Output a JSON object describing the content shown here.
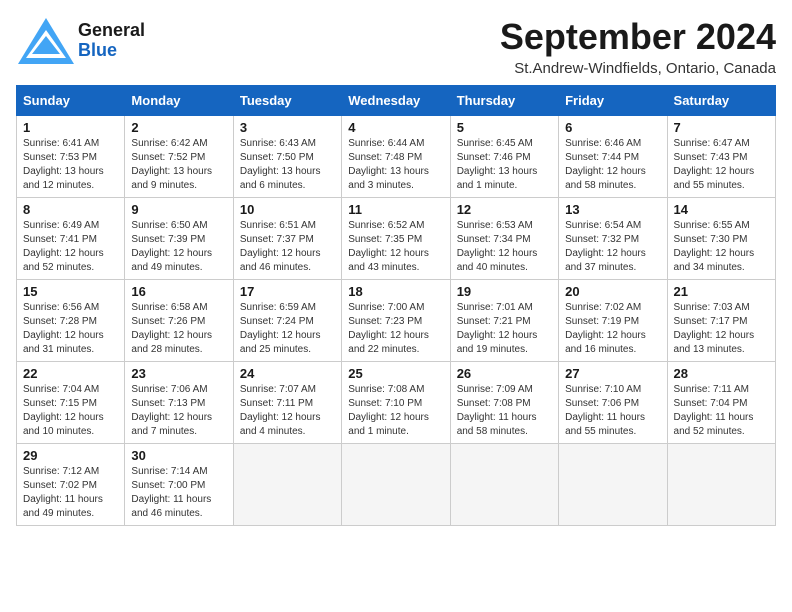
{
  "header": {
    "logo_general": "General",
    "logo_blue": "Blue",
    "month": "September 2024",
    "location": "St.Andrew-Windfields, Ontario, Canada"
  },
  "days_of_week": [
    "Sunday",
    "Monday",
    "Tuesday",
    "Wednesday",
    "Thursday",
    "Friday",
    "Saturday"
  ],
  "weeks": [
    [
      {
        "num": "1",
        "sunrise": "Sunrise: 6:41 AM",
        "sunset": "Sunset: 7:53 PM",
        "daylight": "Daylight: 13 hours and 12 minutes."
      },
      {
        "num": "2",
        "sunrise": "Sunrise: 6:42 AM",
        "sunset": "Sunset: 7:52 PM",
        "daylight": "Daylight: 13 hours and 9 minutes."
      },
      {
        "num": "3",
        "sunrise": "Sunrise: 6:43 AM",
        "sunset": "Sunset: 7:50 PM",
        "daylight": "Daylight: 13 hours and 6 minutes."
      },
      {
        "num": "4",
        "sunrise": "Sunrise: 6:44 AM",
        "sunset": "Sunset: 7:48 PM",
        "daylight": "Daylight: 13 hours and 3 minutes."
      },
      {
        "num": "5",
        "sunrise": "Sunrise: 6:45 AM",
        "sunset": "Sunset: 7:46 PM",
        "daylight": "Daylight: 13 hours and 1 minute."
      },
      {
        "num": "6",
        "sunrise": "Sunrise: 6:46 AM",
        "sunset": "Sunset: 7:44 PM",
        "daylight": "Daylight: 12 hours and 58 minutes."
      },
      {
        "num": "7",
        "sunrise": "Sunrise: 6:47 AM",
        "sunset": "Sunset: 7:43 PM",
        "daylight": "Daylight: 12 hours and 55 minutes."
      }
    ],
    [
      {
        "num": "8",
        "sunrise": "Sunrise: 6:49 AM",
        "sunset": "Sunset: 7:41 PM",
        "daylight": "Daylight: 12 hours and 52 minutes."
      },
      {
        "num": "9",
        "sunrise": "Sunrise: 6:50 AM",
        "sunset": "Sunset: 7:39 PM",
        "daylight": "Daylight: 12 hours and 49 minutes."
      },
      {
        "num": "10",
        "sunrise": "Sunrise: 6:51 AM",
        "sunset": "Sunset: 7:37 PM",
        "daylight": "Daylight: 12 hours and 46 minutes."
      },
      {
        "num": "11",
        "sunrise": "Sunrise: 6:52 AM",
        "sunset": "Sunset: 7:35 PM",
        "daylight": "Daylight: 12 hours and 43 minutes."
      },
      {
        "num": "12",
        "sunrise": "Sunrise: 6:53 AM",
        "sunset": "Sunset: 7:34 PM",
        "daylight": "Daylight: 12 hours and 40 minutes."
      },
      {
        "num": "13",
        "sunrise": "Sunrise: 6:54 AM",
        "sunset": "Sunset: 7:32 PM",
        "daylight": "Daylight: 12 hours and 37 minutes."
      },
      {
        "num": "14",
        "sunrise": "Sunrise: 6:55 AM",
        "sunset": "Sunset: 7:30 PM",
        "daylight": "Daylight: 12 hours and 34 minutes."
      }
    ],
    [
      {
        "num": "15",
        "sunrise": "Sunrise: 6:56 AM",
        "sunset": "Sunset: 7:28 PM",
        "daylight": "Daylight: 12 hours and 31 minutes."
      },
      {
        "num": "16",
        "sunrise": "Sunrise: 6:58 AM",
        "sunset": "Sunset: 7:26 PM",
        "daylight": "Daylight: 12 hours and 28 minutes."
      },
      {
        "num": "17",
        "sunrise": "Sunrise: 6:59 AM",
        "sunset": "Sunset: 7:24 PM",
        "daylight": "Daylight: 12 hours and 25 minutes."
      },
      {
        "num": "18",
        "sunrise": "Sunrise: 7:00 AM",
        "sunset": "Sunset: 7:23 PM",
        "daylight": "Daylight: 12 hours and 22 minutes."
      },
      {
        "num": "19",
        "sunrise": "Sunrise: 7:01 AM",
        "sunset": "Sunset: 7:21 PM",
        "daylight": "Daylight: 12 hours and 19 minutes."
      },
      {
        "num": "20",
        "sunrise": "Sunrise: 7:02 AM",
        "sunset": "Sunset: 7:19 PM",
        "daylight": "Daylight: 12 hours and 16 minutes."
      },
      {
        "num": "21",
        "sunrise": "Sunrise: 7:03 AM",
        "sunset": "Sunset: 7:17 PM",
        "daylight": "Daylight: 12 hours and 13 minutes."
      }
    ],
    [
      {
        "num": "22",
        "sunrise": "Sunrise: 7:04 AM",
        "sunset": "Sunset: 7:15 PM",
        "daylight": "Daylight: 12 hours and 10 minutes."
      },
      {
        "num": "23",
        "sunrise": "Sunrise: 7:06 AM",
        "sunset": "Sunset: 7:13 PM",
        "daylight": "Daylight: 12 hours and 7 minutes."
      },
      {
        "num": "24",
        "sunrise": "Sunrise: 7:07 AM",
        "sunset": "Sunset: 7:11 PM",
        "daylight": "Daylight: 12 hours and 4 minutes."
      },
      {
        "num": "25",
        "sunrise": "Sunrise: 7:08 AM",
        "sunset": "Sunset: 7:10 PM",
        "daylight": "Daylight: 12 hours and 1 minute."
      },
      {
        "num": "26",
        "sunrise": "Sunrise: 7:09 AM",
        "sunset": "Sunset: 7:08 PM",
        "daylight": "Daylight: 11 hours and 58 minutes."
      },
      {
        "num": "27",
        "sunrise": "Sunrise: 7:10 AM",
        "sunset": "Sunset: 7:06 PM",
        "daylight": "Daylight: 11 hours and 55 minutes."
      },
      {
        "num": "28",
        "sunrise": "Sunrise: 7:11 AM",
        "sunset": "Sunset: 7:04 PM",
        "daylight": "Daylight: 11 hours and 52 minutes."
      }
    ],
    [
      {
        "num": "29",
        "sunrise": "Sunrise: 7:12 AM",
        "sunset": "Sunset: 7:02 PM",
        "daylight": "Daylight: 11 hours and 49 minutes."
      },
      {
        "num": "30",
        "sunrise": "Sunrise: 7:14 AM",
        "sunset": "Sunset: 7:00 PM",
        "daylight": "Daylight: 11 hours and 46 minutes."
      },
      null,
      null,
      null,
      null,
      null
    ]
  ]
}
